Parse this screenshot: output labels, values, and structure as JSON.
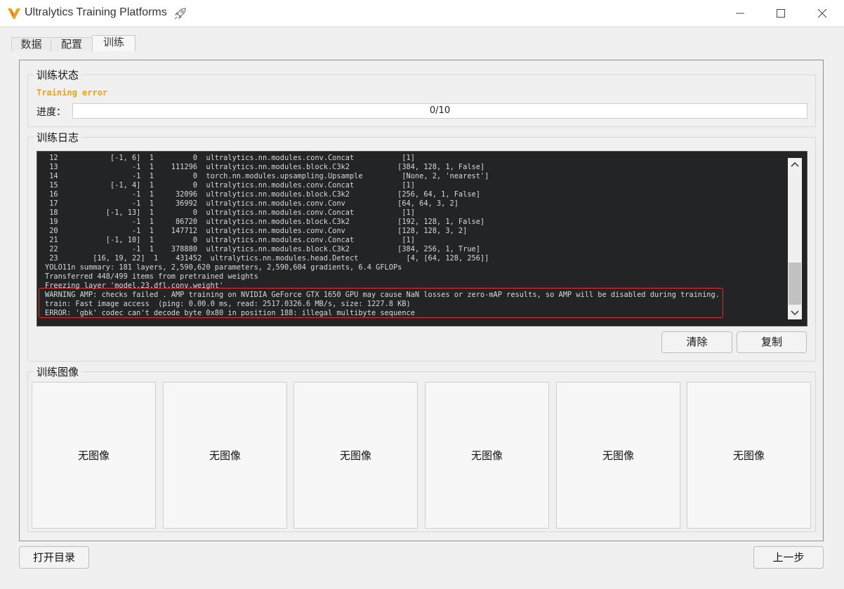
{
  "window": {
    "title": "Ultralytics Training Platforms",
    "brand_color": "#f59c1a"
  },
  "tabs": [
    {
      "label": "数据",
      "active": false
    },
    {
      "label": "配置",
      "active": false
    },
    {
      "label": "训练",
      "active": true
    }
  ],
  "status": {
    "group_title": "训练状态",
    "error_text": "Training error",
    "error_color": "#f5a300",
    "progress_label": "进度：",
    "progress_text": "0/10",
    "progress_fraction": 0.0
  },
  "log": {
    "group_title": "训练日志",
    "lines": [
      " 12            [-1, 6]  1         0  ultralytics.nn.modules.conv.Concat           [1]",
      " 13                 -1  1    111296  ultralytics.nn.modules.block.C3k2           [384, 128, 1, False]",
      " 14                 -1  1         0  torch.nn.modules.upsampling.Upsample         [None, 2, 'nearest']",
      " 15            [-1, 4]  1         0  ultralytics.nn.modules.conv.Concat           [1]",
      " 16                 -1  1     32096  ultralytics.nn.modules.block.C3k2           [256, 64, 1, False]",
      " 17                 -1  1     36992  ultralytics.nn.modules.conv.Conv            [64, 64, 3, 2]",
      " 18           [-1, 13]  1         0  ultralytics.nn.modules.conv.Concat           [1]",
      " 19                 -1  1     86720  ultralytics.nn.modules.block.C3k2           [192, 128, 1, False]",
      " 20                 -1  1    147712  ultralytics.nn.modules.conv.Conv            [128, 128, 3, 2]",
      " 21           [-1, 10]  1         0  ultralytics.nn.modules.conv.Concat           [1]",
      " 22                 -1  1    378880  ultralytics.nn.modules.block.C3k2           [384, 256, 1, True]",
      " 23        [16, 19, 22]  1    431452  ultralytics.nn.modules.head.Detect           [4, [64, 128, 256]]",
      "YOLO11n summary: 181 layers, 2,590,620 parameters, 2,590,604 gradients, 6.4 GFLOPs",
      "Transferred 448/499 items from pretrained weights",
      "Freezing layer 'model.23.dfl.conv.weight'",
      "WARNING AMP: checks failed . AMP training on NVIDIA GeForce GTX 1650 GPU may cause NaN losses or zero-mAP results, so AMP will be disabled during training.",
      "train: Fast image access  (ping: 0.00.0 ms, read: 2517.0326.6 MB/s, size: 1227.8 KB)",
      "ERROR: 'gbk' codec can't decode byte 0x80 in position 188: illegal multibyte sequence"
    ],
    "highlight_color": "#e03030",
    "clear_label": "清除",
    "copy_label": "复制"
  },
  "images": {
    "group_title": "训练图像",
    "slots": [
      "无图像",
      "无图像",
      "无图像",
      "无图像",
      "无图像",
      "无图像"
    ]
  },
  "footer": {
    "open_dir_label": "打开目录",
    "prev_label": "上一步"
  }
}
